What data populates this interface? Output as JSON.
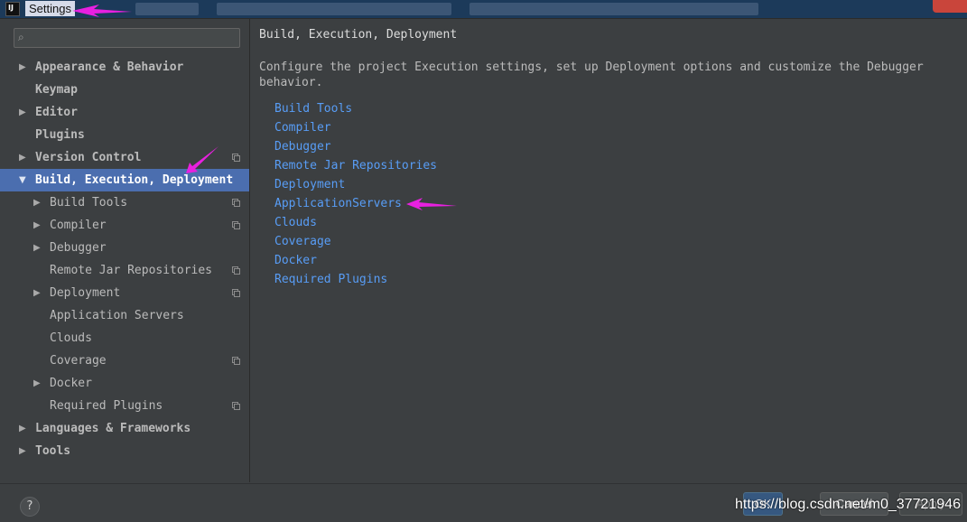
{
  "window": {
    "title": "Settings",
    "app_icon_text": "IJ"
  },
  "search": {
    "placeholder": "",
    "value": ""
  },
  "tree": [
    {
      "label": "Appearance & Behavior",
      "level": 0,
      "arrow": "right",
      "copy": false,
      "selected": false
    },
    {
      "label": "Keymap",
      "level": 0,
      "arrow": "none",
      "copy": false,
      "selected": false
    },
    {
      "label": "Editor",
      "level": 0,
      "arrow": "right",
      "copy": false,
      "selected": false
    },
    {
      "label": "Plugins",
      "level": 0,
      "arrow": "none",
      "copy": false,
      "selected": false
    },
    {
      "label": "Version Control",
      "level": 0,
      "arrow": "right",
      "copy": true,
      "selected": false
    },
    {
      "label": "Build, Execution, Deployment",
      "level": 0,
      "arrow": "down",
      "copy": false,
      "selected": true
    },
    {
      "label": "Build Tools",
      "level": 1,
      "arrow": "right",
      "copy": true,
      "selected": false
    },
    {
      "label": "Compiler",
      "level": 1,
      "arrow": "right",
      "copy": true,
      "selected": false
    },
    {
      "label": "Debugger",
      "level": 1,
      "arrow": "right",
      "copy": false,
      "selected": false
    },
    {
      "label": "Remote Jar Repositories",
      "level": 1,
      "arrow": "none",
      "copy": true,
      "selected": false
    },
    {
      "label": "Deployment",
      "level": 1,
      "arrow": "right",
      "copy": true,
      "selected": false
    },
    {
      "label": "Application Servers",
      "level": 1,
      "arrow": "none",
      "copy": false,
      "selected": false
    },
    {
      "label": "Clouds",
      "level": 1,
      "arrow": "none",
      "copy": false,
      "selected": false
    },
    {
      "label": "Coverage",
      "level": 1,
      "arrow": "none",
      "copy": true,
      "selected": false
    },
    {
      "label": "Docker",
      "level": 1,
      "arrow": "right",
      "copy": false,
      "selected": false
    },
    {
      "label": "Required Plugins",
      "level": 1,
      "arrow": "none",
      "copy": true,
      "selected": false
    },
    {
      "label": "Languages & Frameworks",
      "level": 0,
      "arrow": "right",
      "copy": false,
      "selected": false
    },
    {
      "label": "Tools",
      "level": 0,
      "arrow": "right",
      "copy": false,
      "selected": false
    }
  ],
  "content": {
    "heading": "Build, Execution, Deployment",
    "description": "Configure the project Execution settings, set up Deployment options and customize the Debugger behavior.",
    "links": [
      "Build Tools",
      "Compiler",
      "Debugger",
      "Remote Jar Repositories",
      "Deployment",
      "ApplicationServers",
      "Clouds",
      "Coverage",
      "Docker",
      "Required Plugins"
    ]
  },
  "footer": {
    "help": "?",
    "ok": "OK",
    "cancel": "Cancel",
    "apply": "Apply",
    "watermark": "https://blog.csdn.net/m0_37721946"
  },
  "colors": {
    "background": "#3c3f41",
    "selection": "#4b6eaf",
    "link": "#589df6",
    "annotation": "#e820e0"
  },
  "icons": {
    "expand": "triangle-right-icon",
    "collapse": "triangle-down-icon",
    "project_level": "copy-icon",
    "search": "search-icon",
    "help": "help-icon"
  }
}
